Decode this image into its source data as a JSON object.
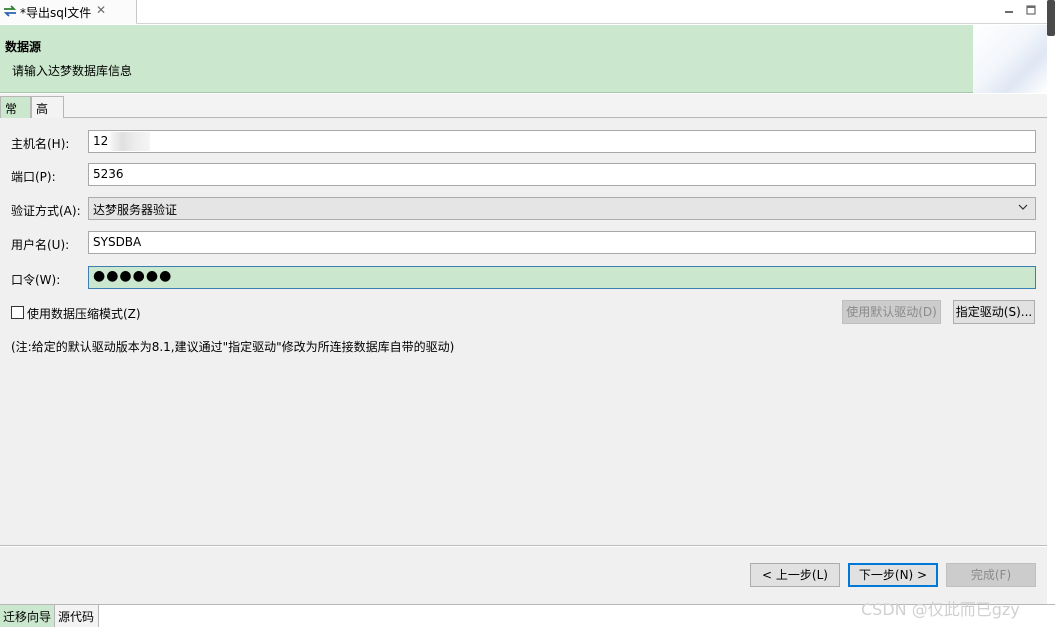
{
  "editor_tab": {
    "title": "*导出sql文件"
  },
  "header": {
    "title": "数据源",
    "description": "请输入达梦数据库信息"
  },
  "inner_tabs": [
    {
      "label": "常规"
    },
    {
      "label": "高级"
    }
  ],
  "form": {
    "host": {
      "label": "主机名(H):",
      "value": "12        27"
    },
    "port": {
      "label": "端口(P):",
      "value": "5236"
    },
    "auth": {
      "label": "验证方式(A):",
      "value": "达梦服务器验证"
    },
    "username": {
      "label": "用户名(U):",
      "value": "SYSDBA"
    },
    "password": {
      "label": "口令(W):",
      "value": "●●●●●●"
    },
    "compress": {
      "label": "使用数据压缩模式(Z)",
      "checked": false
    },
    "default_driver_label": "使用默认驱动(D)",
    "specify_driver_label": "指定驱动(S)...",
    "note": "(注:给定的默认驱动版本为8.1,建议通过\"指定驱动\"修改为所连接数据库自带的驱动)"
  },
  "footer": {
    "back_label": "< 上一步(L)",
    "next_label": "下一步(N) >",
    "finish_label": "完成(F)"
  },
  "bottom_tabs": [
    {
      "label": "迁移向导"
    },
    {
      "label": "源代码"
    }
  ],
  "watermark": "CSDN @仅此而已gzy",
  "colors": {
    "header_bg": "#cbe8ce",
    "focus_border": "#3c7fb1",
    "primary_button_border": "#0078d7"
  }
}
